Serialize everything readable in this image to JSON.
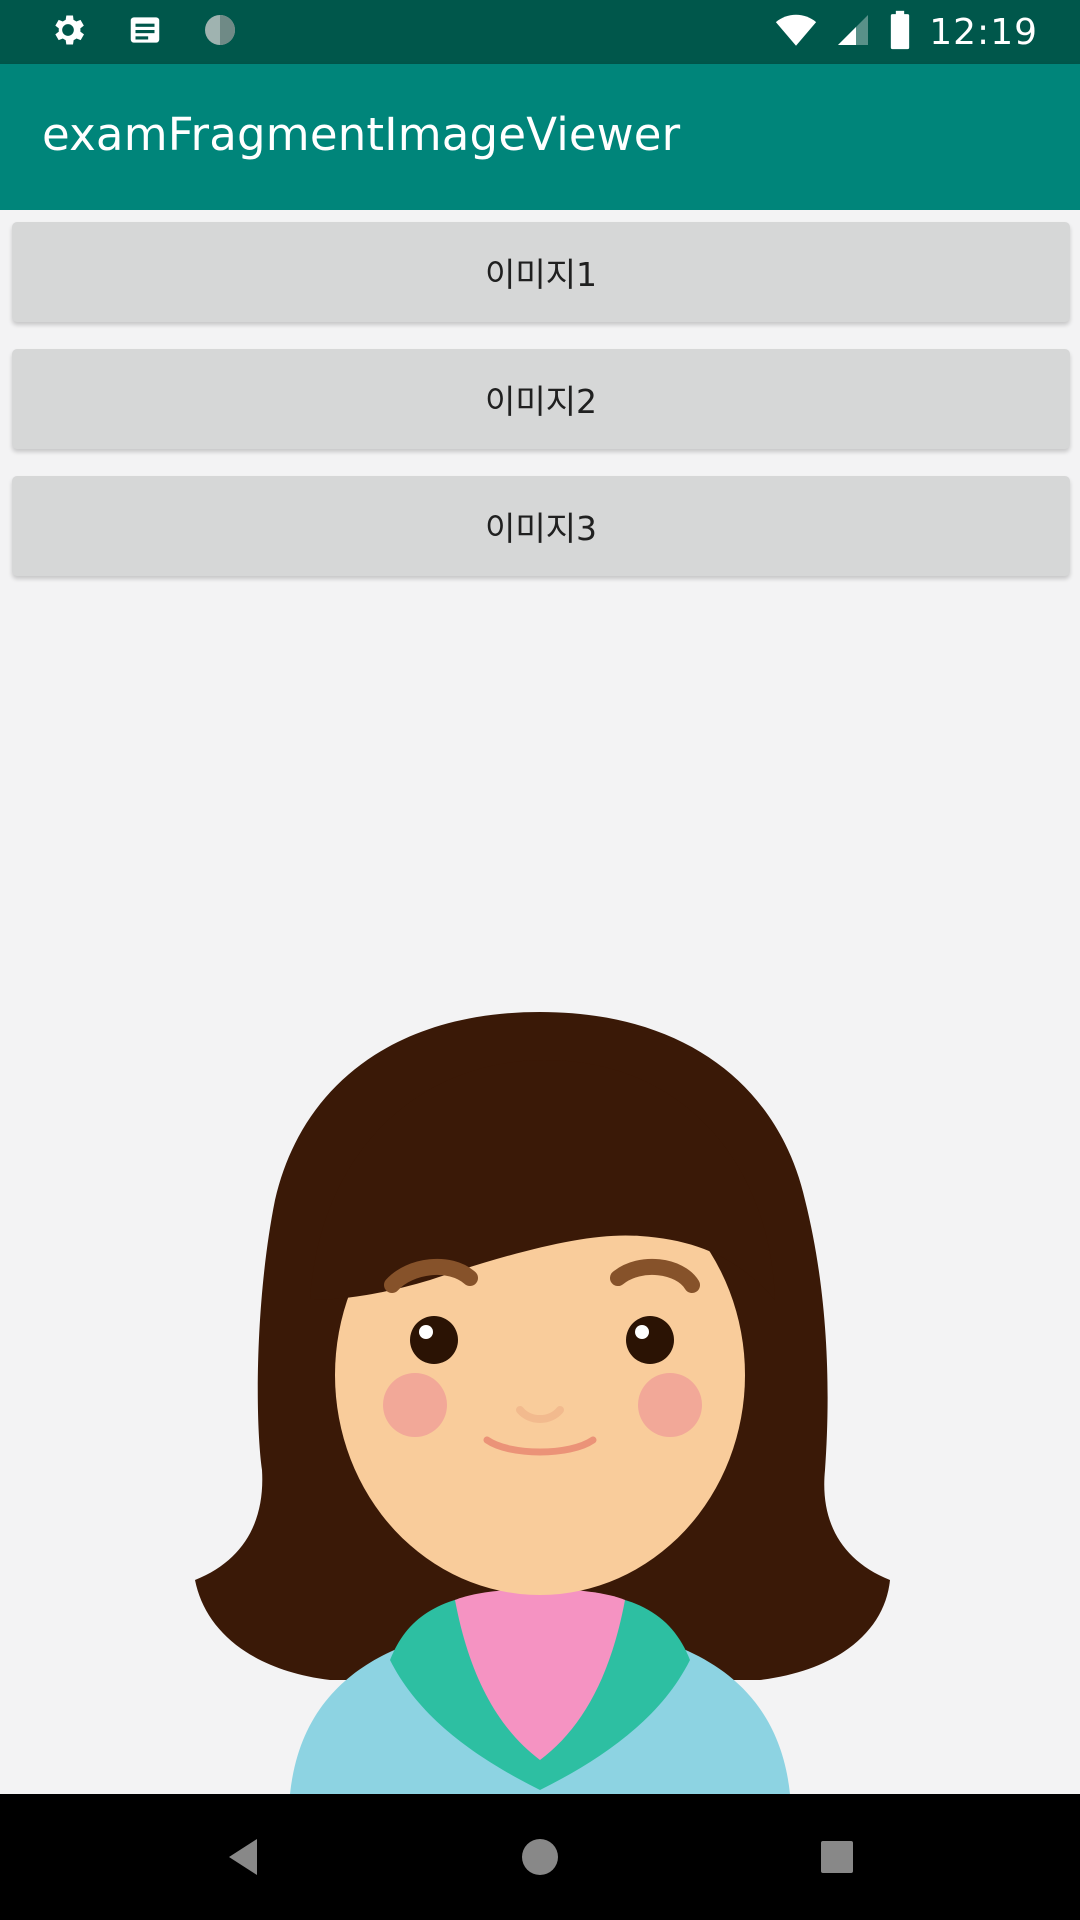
{
  "status_bar": {
    "time": "12:19",
    "left_icons": [
      "gear-icon",
      "notification-card-icon",
      "sync-circle-icon"
    ],
    "right_icons": [
      "wifi-icon",
      "cell-signal-icon",
      "battery-icon"
    ]
  },
  "app_bar": {
    "title": "examFragmentImageViewer",
    "color": "#00857a",
    "status_color": "#00574b"
  },
  "buttons": [
    {
      "label": "이미지1"
    },
    {
      "label": "이미지2"
    },
    {
      "label": "이미지3"
    }
  ],
  "image": {
    "subject": "girl-avatar-illustration"
  },
  "nav_bar": {
    "icons": [
      "back-icon",
      "home-icon",
      "recents-icon"
    ]
  }
}
